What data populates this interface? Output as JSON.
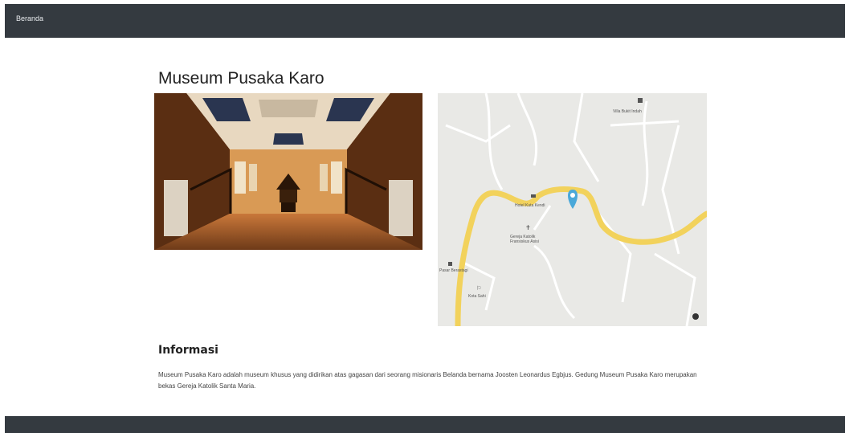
{
  "nav": {
    "brand": "Beranda"
  },
  "museum": {
    "title": "Museum Pusaka Karo",
    "photo_alt": "Museum Pusaka Karo"
  },
  "map": {
    "labels": {
      "villa": "Villa Bukit Indah",
      "hotel": "Hotel Kuta Kendi",
      "church": "Gereja Katolik Fransiskus Asisi",
      "market": "Pasar Berastagi",
      "school": "Kota Sahi"
    },
    "colors": {
      "road": "#f2d25c",
      "marker": "#4aa8d9",
      "land": "#e9e9e6",
      "street": "#ffffff"
    }
  },
  "info": {
    "heading": "Informasi",
    "text": "Museum Pusaka Karo adalah museum khusus yang didirikan atas gagasan dari seorang misionaris Belanda bernama Joosten Leonardus Egbjus. Gedung Museum Pusaka Karo merupakan bekas Gereja Katolik Santa Maria."
  }
}
